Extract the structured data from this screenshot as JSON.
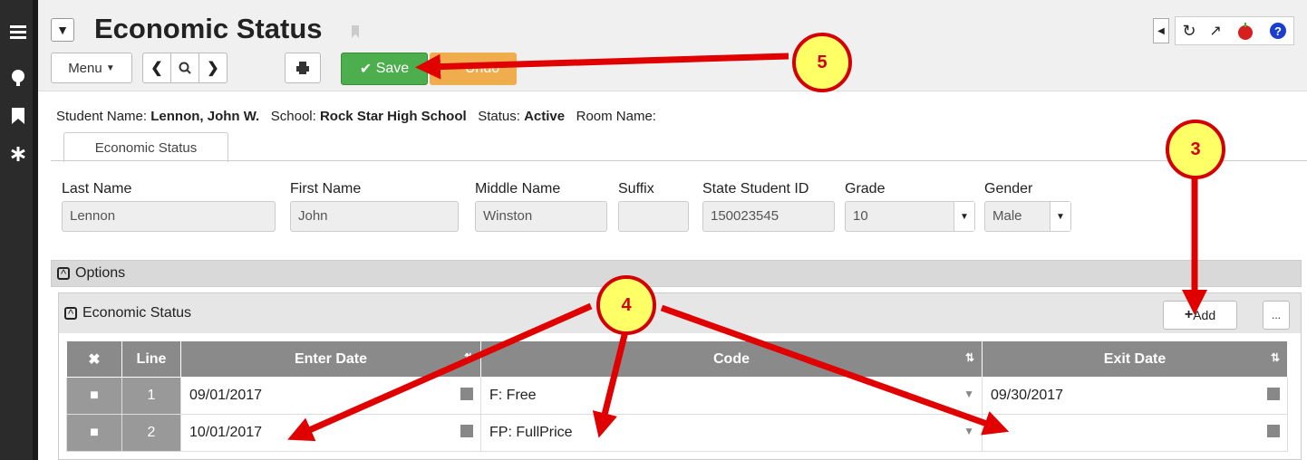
{
  "page": {
    "title": "Economic Status"
  },
  "toolbar": {
    "menu_label": "Menu",
    "save_label": "Save",
    "undo_label": "Undo"
  },
  "student": {
    "name_label": "Student Name:",
    "name": "Lennon, John W.",
    "school_label": "School:",
    "school": "Rock Star High School",
    "status_label": "Status:",
    "status": "Active",
    "room_label": "Room Name:"
  },
  "tabs": [
    {
      "label": "Economic Status"
    }
  ],
  "fields": {
    "last_name": {
      "label": "Last Name",
      "value": "Lennon"
    },
    "first_name": {
      "label": "First Name",
      "value": "John"
    },
    "middle_name": {
      "label": "Middle Name",
      "value": "Winston"
    },
    "suffix": {
      "label": "Suffix",
      "value": ""
    },
    "state_id": {
      "label": "State Student ID",
      "value": "150023545"
    },
    "grade": {
      "label": "Grade",
      "value": "10"
    },
    "gender": {
      "label": "Gender",
      "value": "Male"
    }
  },
  "sections": {
    "options": "Options",
    "econ": "Economic Status"
  },
  "econ": {
    "add_label": "Add",
    "more_label": "...",
    "columns": [
      "",
      "Line",
      "Enter Date",
      "Code",
      "Exit Date"
    ],
    "rows": [
      {
        "line": "1",
        "enter": "09/01/2017",
        "code": "F: Free",
        "exit": "09/30/2017"
      },
      {
        "line": "2",
        "enter": "10/01/2017",
        "code": "FP: FullPrice",
        "exit": ""
      }
    ]
  },
  "callouts": {
    "c3": "3",
    "c4": "4",
    "c5": "5"
  }
}
